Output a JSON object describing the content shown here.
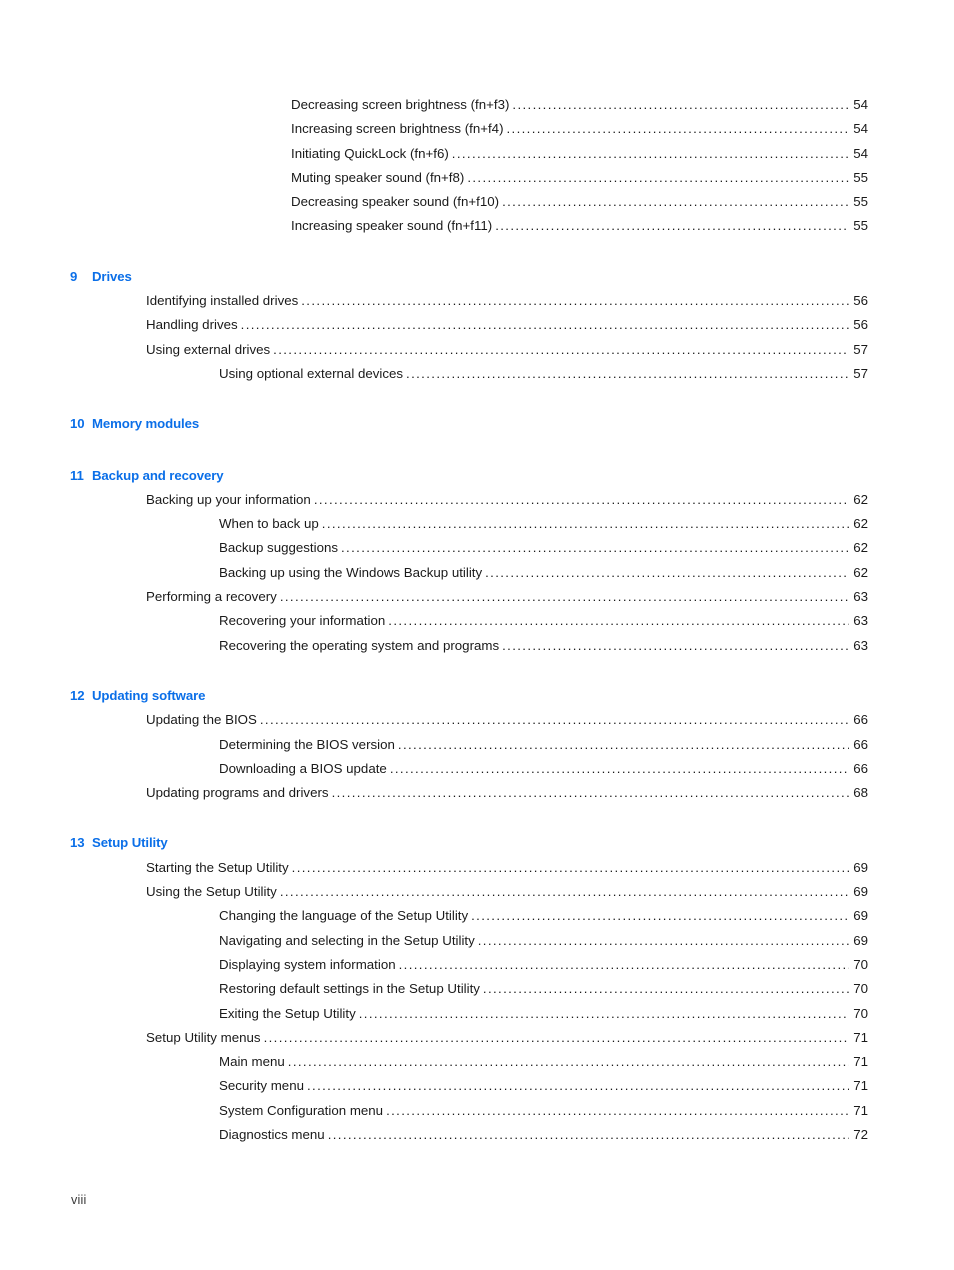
{
  "page": {
    "folio": "viii",
    "accent_color": "#0b6fe8",
    "text_color": "#1a1a1a",
    "background_color": "#ffffff"
  },
  "toc": {
    "groups": [
      {
        "heading": null,
        "entries": [
          {
            "level": 3,
            "label": "Decreasing screen brightness (fn+f3)",
            "page": "54"
          },
          {
            "level": 3,
            "label": "Increasing screen brightness (fn+f4)",
            "page": "54"
          },
          {
            "level": 3,
            "label": "Initiating QuickLock (fn+f6)",
            "page": "54"
          },
          {
            "level": 3,
            "label": "Muting speaker sound (fn+f8)",
            "page": "55"
          },
          {
            "level": 3,
            "label": "Decreasing speaker sound (fn+f10)",
            "page": "55"
          },
          {
            "level": 3,
            "label": "Increasing speaker sound (fn+f11)",
            "page": "55"
          }
        ]
      },
      {
        "heading": {
          "number": "9",
          "title": "Drives"
        },
        "entries": [
          {
            "level": 1,
            "label": "Identifying installed drives",
            "page": "56"
          },
          {
            "level": 1,
            "label": "Handling drives",
            "page": "56"
          },
          {
            "level": 1,
            "label": "Using external drives",
            "page": "57"
          },
          {
            "level": 2,
            "label": "Using optional external devices",
            "page": "57"
          }
        ]
      },
      {
        "heading": {
          "number": "10",
          "title": "Memory modules"
        },
        "entries": []
      },
      {
        "heading": {
          "number": "11",
          "title": "Backup and recovery"
        },
        "entries": [
          {
            "level": 1,
            "label": "Backing up your information",
            "page": "62"
          },
          {
            "level": 2,
            "label": "When to back up",
            "page": "62"
          },
          {
            "level": 2,
            "label": "Backup suggestions",
            "page": "62"
          },
          {
            "level": 2,
            "label": "Backing up using the Windows Backup utility",
            "page": "62"
          },
          {
            "level": 1,
            "label": "Performing a recovery",
            "page": "63"
          },
          {
            "level": 2,
            "label": "Recovering your information",
            "page": "63"
          },
          {
            "level": 2,
            "label": "Recovering the operating system and programs",
            "page": "63"
          }
        ]
      },
      {
        "heading": {
          "number": "12",
          "title": "Updating software"
        },
        "entries": [
          {
            "level": 1,
            "label": "Updating the BIOS",
            "page": "66"
          },
          {
            "level": 2,
            "label": "Determining the BIOS version",
            "page": "66"
          },
          {
            "level": 2,
            "label": "Downloading a BIOS update",
            "page": "66"
          },
          {
            "level": 1,
            "label": "Updating programs and drivers",
            "page": "68"
          }
        ]
      },
      {
        "heading": {
          "number": "13",
          "title": "Setup Utility"
        },
        "entries": [
          {
            "level": 1,
            "label": "Starting the Setup Utility",
            "page": "69"
          },
          {
            "level": 1,
            "label": "Using the Setup Utility",
            "page": "69"
          },
          {
            "level": 2,
            "label": "Changing the language of the Setup Utility",
            "page": "69"
          },
          {
            "level": 2,
            "label": "Navigating and selecting in the Setup Utility",
            "page": "69"
          },
          {
            "level": 2,
            "label": "Displaying system information",
            "page": "70"
          },
          {
            "level": 2,
            "label": "Restoring default settings in the Setup Utility",
            "page": "70"
          },
          {
            "level": 2,
            "label": "Exiting the Setup Utility",
            "page": "70"
          },
          {
            "level": 1,
            "label": "Setup Utility menus",
            "page": "71"
          },
          {
            "level": 2,
            "label": "Main menu",
            "page": "71"
          },
          {
            "level": 2,
            "label": "Security menu",
            "page": "71"
          },
          {
            "level": 2,
            "label": "System Configuration menu",
            "page": "71"
          },
          {
            "level": 2,
            "label": "Diagnostics menu",
            "page": "72"
          }
        ]
      }
    ]
  }
}
